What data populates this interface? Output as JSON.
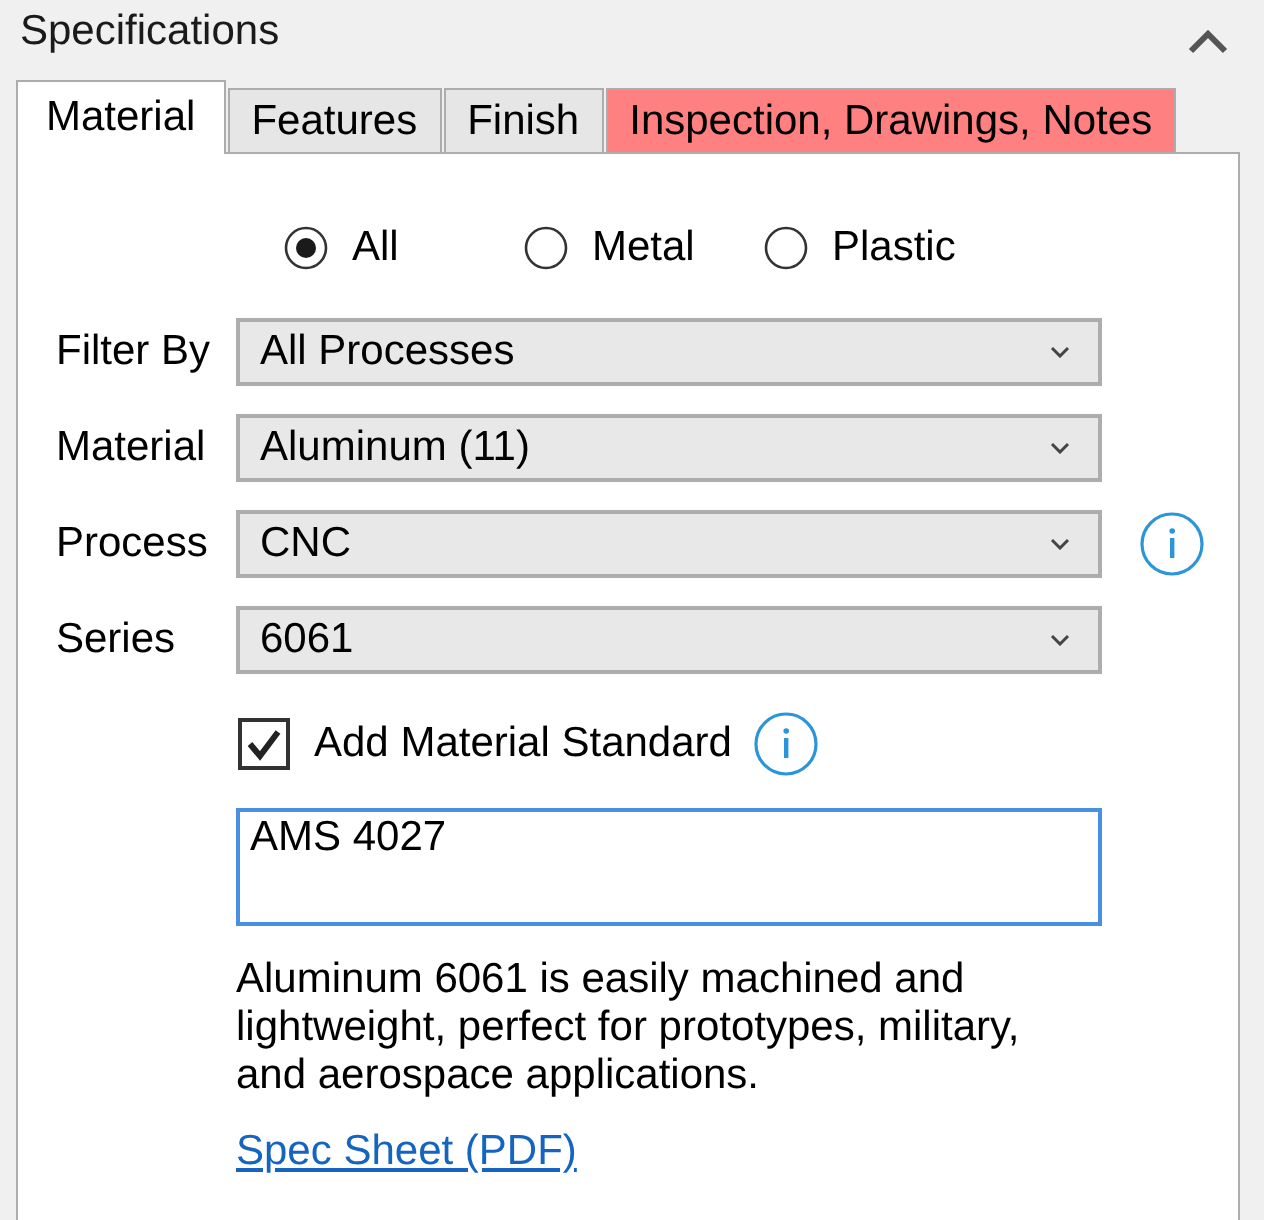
{
  "panel": {
    "title": "Specifications",
    "expanded": true
  },
  "tabs": [
    {
      "label": "Material",
      "selected": true
    },
    {
      "label": "Features",
      "selected": false
    },
    {
      "label": "Finish",
      "selected": false
    },
    {
      "label": "Inspection, Drawings, Notes",
      "selected": false,
      "color": "#ff8080"
    }
  ],
  "material_type": [
    {
      "label": "All",
      "selected": true
    },
    {
      "label": "Metal",
      "selected": false
    },
    {
      "label": "Plastic",
      "selected": false
    }
  ],
  "fields": [
    {
      "label": "Filter By",
      "value": "All Processes",
      "info": false
    },
    {
      "label": "Material",
      "value": "Aluminum (11)",
      "info": false
    },
    {
      "label": "Process",
      "value": "CNC",
      "info": true
    },
    {
      "label": "Series",
      "value": "6061",
      "info": false
    }
  ],
  "material_standard": {
    "label": "Add Material Standard",
    "checked": true,
    "info": true,
    "value": "AMS 4027",
    "focused": true
  },
  "description": "Aluminum 6061 is easily machined and lightweight, perfect for prototypes, military, and aerospace applications.",
  "link": "Spec Sheet (PDF)"
}
